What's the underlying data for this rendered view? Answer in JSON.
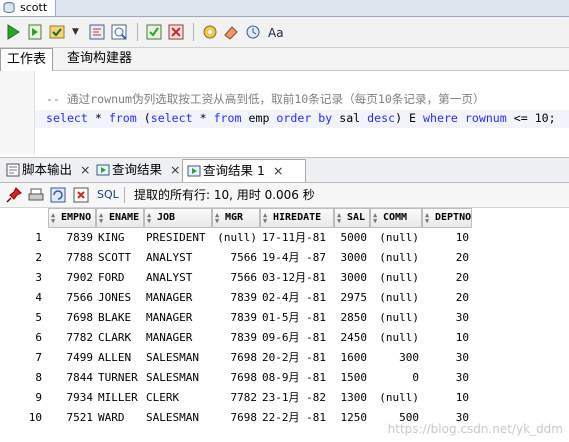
{
  "window": {
    "tab_title": "scott"
  },
  "subtabs": {
    "worksheet": "工作表",
    "query_builder": "查询构建器"
  },
  "editor": {
    "line1_comment": "-- 通过rownum伪列选取按工资从高到低，取前10条记录（每页10条记录，第一页）",
    "line2": [
      {
        "t": "select ",
        "c": "kw"
      },
      {
        "t": "*",
        "c": "plain"
      },
      {
        "t": " from ",
        "c": "kw"
      },
      {
        "t": "(",
        "c": "plain"
      },
      {
        "t": "select ",
        "c": "kw"
      },
      {
        "t": "*",
        "c": "plain"
      },
      {
        "t": " from ",
        "c": "kw"
      },
      {
        "t": "emp ",
        "c": "plain"
      },
      {
        "t": "order by ",
        "c": "kw"
      },
      {
        "t": "sal ",
        "c": "plain"
      },
      {
        "t": "desc",
        "c": "kw"
      },
      {
        "t": ") E ",
        "c": "plain"
      },
      {
        "t": "where ",
        "c": "kw"
      },
      {
        "t": "rownum",
        "c": "kw"
      },
      {
        "t": " <= 10;",
        "c": "plain"
      }
    ]
  },
  "result_tabs": [
    {
      "label": "脚本输出",
      "close": "×"
    },
    {
      "label": "查询结果",
      "close": "×"
    },
    {
      "label": "查询结果 1",
      "close": "×"
    }
  ],
  "info": {
    "sql_label": "SQL",
    "fetch_text": "提取的所有行: 10, 用时 0.006 秒"
  },
  "table": {
    "columns": [
      "EMPNO",
      "ENAME",
      "JOB",
      "MGR",
      "HIREDATE",
      "SAL",
      "COMM",
      "DEPTNO"
    ],
    "rows": [
      [
        "1",
        "7839",
        "KING",
        "PRESIDENT",
        "(null)",
        "17-11月-81",
        "5000",
        "(null)",
        "10"
      ],
      [
        "2",
        "7788",
        "SCOTT",
        "ANALYST",
        "7566",
        "19-4月 -87",
        "3000",
        "(null)",
        "20"
      ],
      [
        "3",
        "7902",
        "FORD",
        "ANALYST",
        "7566",
        "03-12月-81",
        "3000",
        "(null)",
        "20"
      ],
      [
        "4",
        "7566",
        "JONES",
        "MANAGER",
        "7839",
        "02-4月 -81",
        "2975",
        "(null)",
        "20"
      ],
      [
        "5",
        "7698",
        "BLAKE",
        "MANAGER",
        "7839",
        "01-5月 -81",
        "2850",
        "(null)",
        "30"
      ],
      [
        "6",
        "7782",
        "CLARK",
        "MANAGER",
        "7839",
        "09-6月 -81",
        "2450",
        "(null)",
        "10"
      ],
      [
        "7",
        "7499",
        "ALLEN",
        "SALESMAN",
        "7698",
        "20-2月 -81",
        "1600",
        "300",
        "30"
      ],
      [
        "8",
        "7844",
        "TURNER",
        "SALESMAN",
        "7698",
        "08-9月 -81",
        "1500",
        "0",
        "30"
      ],
      [
        "9",
        "7934",
        "MILLER",
        "CLERK",
        "7782",
        "23-1月 -82",
        "1300",
        "(null)",
        "10"
      ],
      [
        "10",
        "7521",
        "WARD",
        "SALESMAN",
        "7698",
        "22-2月 -81",
        "1250",
        "500",
        "30"
      ]
    ]
  },
  "watermark": "https://blog.csdn.net/yk_ddm",
  "colors": {
    "keyword": "#2b2bff",
    "comment": "#808080",
    "accent": "#1a3b8a"
  }
}
